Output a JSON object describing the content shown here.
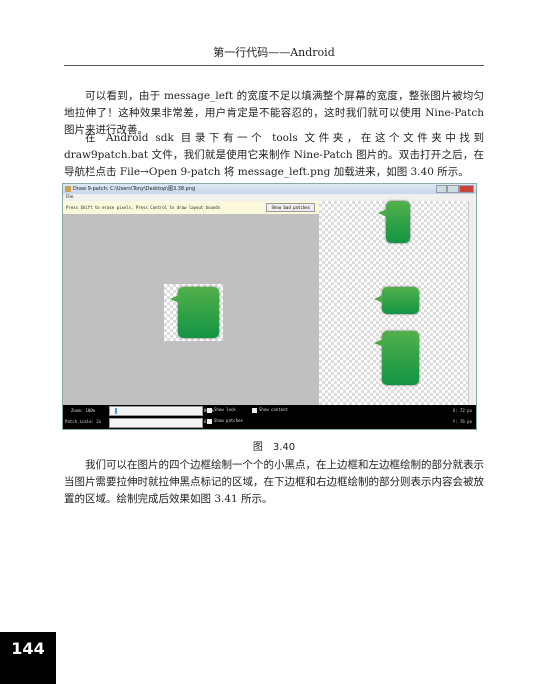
{
  "header": "第一行代码——Android",
  "paragraphs": [
    "可以看到，由于 message_left 的宽度不足以填满整个屏幕的宽度，整张图片被均匀地拉伸了！这种效果非常差，用户肯定是不能容忍的，这时我们就可以使用 Nine-Patch 图片来进行改善。",
    "在 Android sdk 目录下有一个 tools 文件夹，在这个文件夹中找到 draw9patch.bat 文件，我们就是使用它来制作 Nine-Patch 图片的。双击打开之后，在导航栏点击 File→Open 9-patch 将 message_left.png 加载进来，如图 3.40 所示。",
    "我们可以在图片的四个边框绘制一个个的小黑点，在上边框和左边框绘制的部分就表示当图片需要拉伸时就拉伸黑点标记的区域，在下边框和右边框绘制的部分则表示内容会被放置的区域。绘制完成后效果如图 3.41 所示。"
  ],
  "screenshot": {
    "title": "Draw 9-patch: C:\\Users\\Tony\\Desktop\\图3.38.png",
    "menu": "File",
    "hint": "Press Shift to erase pixels. Press Control to draw layout bounds",
    "show_bad_patches": "Show bad patches",
    "zoom_label": "Zoom: 100%",
    "zoom_max": "800%",
    "zoom_value": 0.05,
    "patch_label": "Patch scale:  2x",
    "patch_max": "6x",
    "show_lock": "Show lock",
    "show_content": "Show content",
    "show_patches": "Show patches",
    "x_readout": "X: 72 px",
    "y_readout": "Y: 76 px",
    "bubble_color": "#1f9a45"
  },
  "caption": "图　3.40",
  "page_number": "144"
}
